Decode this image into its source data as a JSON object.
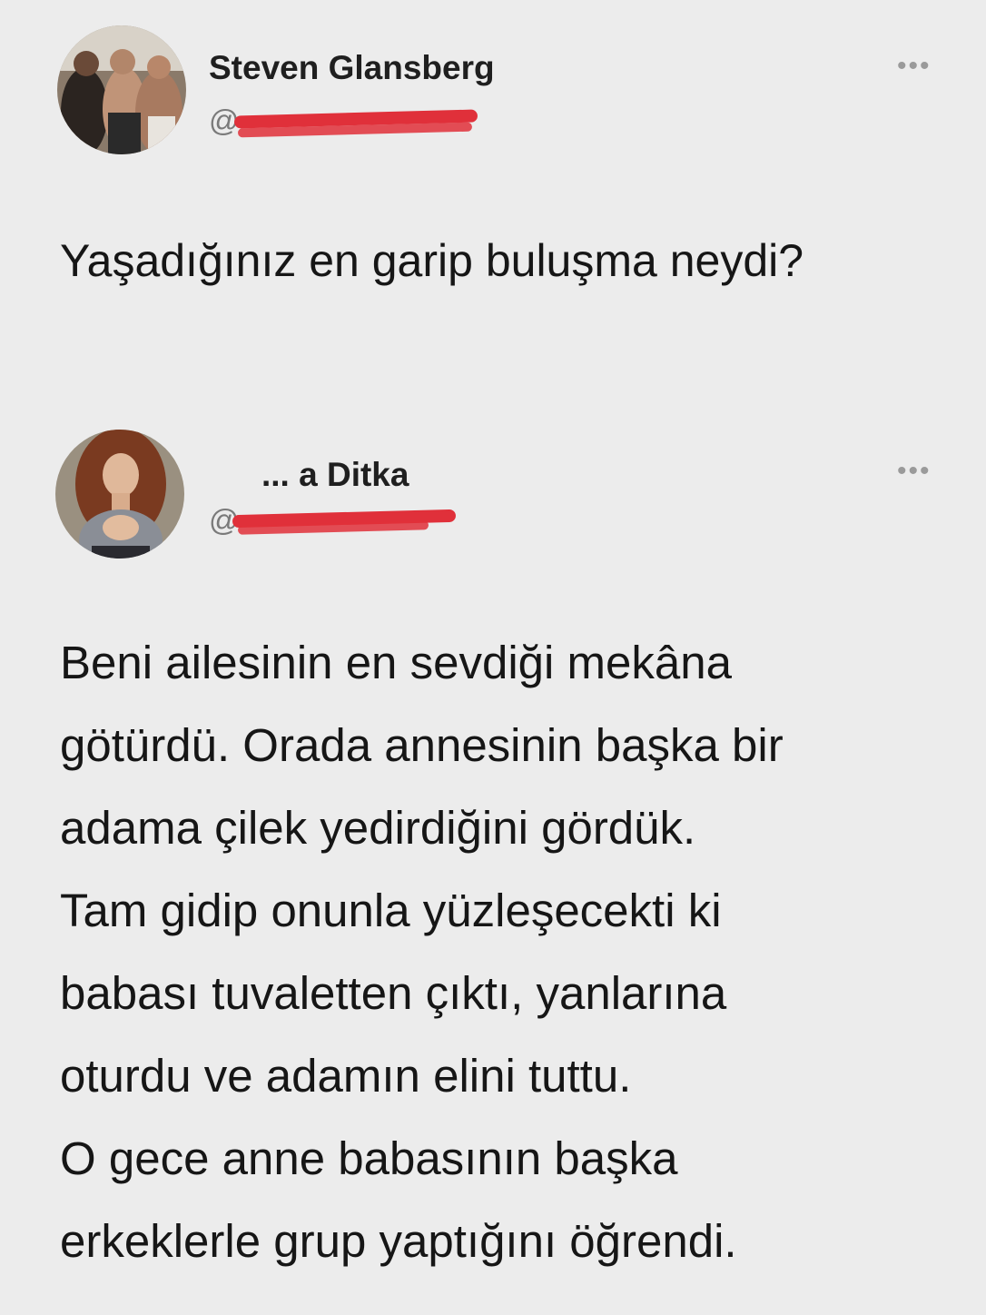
{
  "tweets": [
    {
      "name": "Steven Glansberg",
      "handle": "@",
      "more": "•••",
      "text_lines": [
        "Yaşadığınız en garip buluşma neydi?"
      ]
    },
    {
      "name": "... a Ditka",
      "handle": "@",
      "more": "•••",
      "text_lines": [
        "Beni ailesinin en sevdiği mekâna",
        "götürdü. Orada annesinin başka bir",
        "adama çilek yedirdiğini gördük.",
        "Tam gidip onunla yüzleşecekti ki",
        "babası tuvaletten çıktı, yanlarına",
        "oturdu ve adamın elini tuttu.",
        "O gece anne babasının başka",
        "erkeklerle grup yaptığını öğrendi."
      ]
    }
  ],
  "colors": {
    "background": "#ececec",
    "name": "#1f1f1f",
    "handle": "#7a7a7a",
    "redaction": "#e0303a",
    "more_icon": "#9a9a9a"
  },
  "icons": [
    "more-options-icon"
  ]
}
